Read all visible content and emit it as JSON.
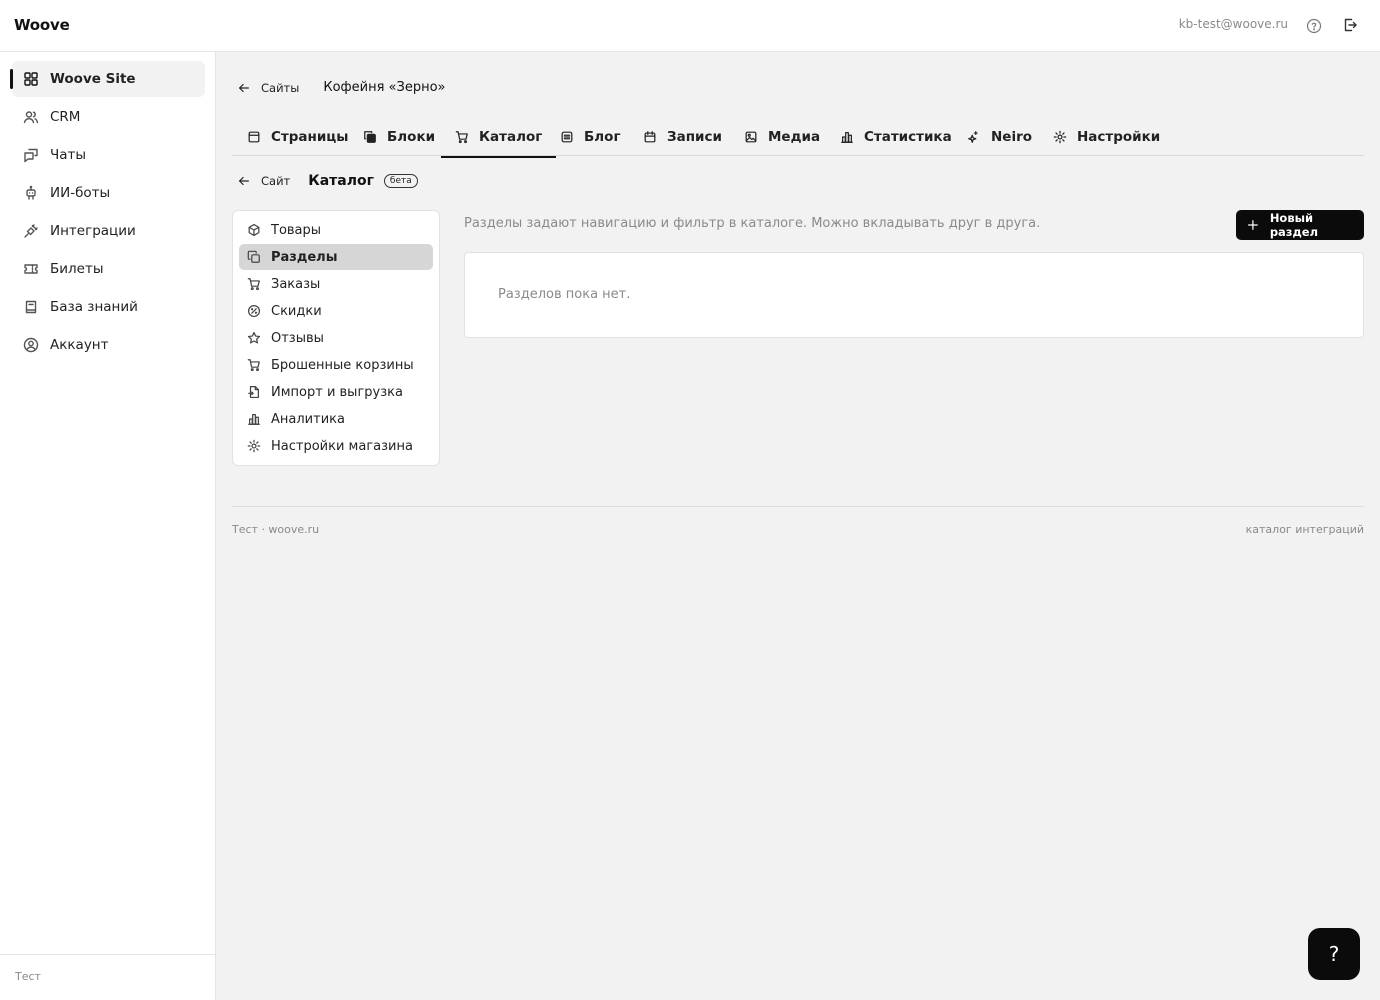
{
  "app": {
    "logo": "Woove",
    "user_email": "kb-test@woove.ru",
    "help_icon": "help-circle-icon",
    "logout_icon": "logout-icon"
  },
  "sidebar": {
    "items": [
      {
        "label": "Woove Site",
        "icon": "grid-icon",
        "active": true
      },
      {
        "label": "CRM",
        "icon": "users-icon"
      },
      {
        "label": "Чаты",
        "icon": "chat-icon"
      },
      {
        "label": "ИИ-боты",
        "icon": "bot-icon"
      },
      {
        "label": "Интеграции",
        "icon": "plug-icon"
      },
      {
        "label": "Билеты",
        "icon": "ticket-icon"
      },
      {
        "label": "База знаний",
        "icon": "book-icon"
      },
      {
        "label": "Аккаунт",
        "icon": "user-circle-icon"
      }
    ],
    "footer": "Тест"
  },
  "breadcrumb": {
    "back_label": "Сайты",
    "site_name": "Кофейня «Зерно»"
  },
  "tabs": [
    {
      "label": "Страницы",
      "icon": "page-icon"
    },
    {
      "label": "Блоки",
      "icon": "blocks-icon"
    },
    {
      "label": "Каталог",
      "icon": "cart-icon",
      "active": true
    },
    {
      "label": "Блог",
      "icon": "list-icon"
    },
    {
      "label": "Записи",
      "icon": "calendar-icon"
    },
    {
      "label": "Медиа",
      "icon": "image-icon"
    },
    {
      "label": "Статистика",
      "icon": "chart-icon"
    },
    {
      "label": "Neiro",
      "icon": "sparkle-icon"
    },
    {
      "label": "Настройки",
      "icon": "gear-icon"
    }
  ],
  "catalog": {
    "back_label": "Сайт",
    "title": "Каталог",
    "badge": "бета",
    "menu": [
      {
        "label": "Товары",
        "icon": "box-icon"
      },
      {
        "label": "Разделы",
        "icon": "copy-icon",
        "active": true
      },
      {
        "label": "Заказы",
        "icon": "cart-icon"
      },
      {
        "label": "Скидки",
        "icon": "percent-icon"
      },
      {
        "label": "Отзывы",
        "icon": "star-icon"
      },
      {
        "label": "Брошенные корзины",
        "icon": "cart-icon"
      },
      {
        "label": "Импорт и выгрузка",
        "icon": "file-icon"
      },
      {
        "label": "Аналитика",
        "icon": "chart-icon"
      },
      {
        "label": "Настройки магазина",
        "icon": "gear-icon"
      }
    ],
    "hint": "Разделы задают навигацию и фильтр в каталоге. Можно вкладывать друг в друга.",
    "new_button": "Новый раздел",
    "empty_text": "Разделов пока нет."
  },
  "footer": {
    "left": "Тест · woove.ru",
    "right": "каталог интеграций"
  },
  "help_fab": "?"
}
